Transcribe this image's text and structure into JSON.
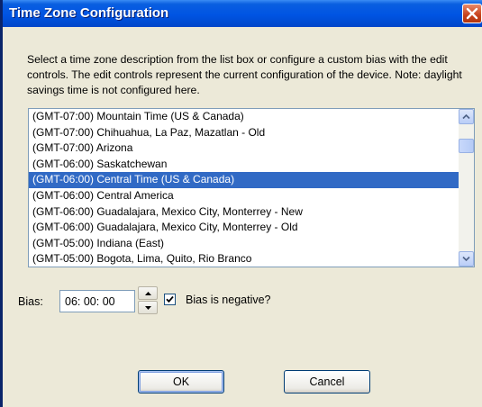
{
  "window": {
    "title": "Time Zone Configuration",
    "description": "Select a time zone description from the list box or configure a custom bias with the edit controls.  The edit controls represent the current configuration of the device.  Note: daylight savings time is not configured here."
  },
  "timezones": {
    "items": [
      "(GMT-07:00) Mountain Time (US & Canada)",
      "(GMT-07:00) Chihuahua, La Paz, Mazatlan - Old",
      "(GMT-07:00) Arizona",
      "(GMT-06:00) Saskatchewan",
      "(GMT-06:00) Central Time (US & Canada)",
      "(GMT-06:00) Central America",
      "(GMT-06:00) Guadalajara, Mexico City, Monterrey - New",
      "(GMT-06:00) Guadalajara, Mexico City, Monterrey - Old",
      "(GMT-05:00) Indiana (East)",
      "(GMT-05:00) Bogota, Lima, Quito, Rio Branco"
    ],
    "selected": "(GMT-06:00) Central Time (US & Canada)"
  },
  "bias": {
    "label": "Bias:",
    "value": "06: 00: 00"
  },
  "negative": {
    "label": "Bias is negative?",
    "checked": true
  },
  "buttons": {
    "ok": "OK",
    "cancel": "Cancel"
  },
  "icons": {
    "close": "close-icon",
    "scroll_up": "chevron-up-icon",
    "scroll_down": "chevron-down-icon",
    "spin_up": "triangle-up-icon",
    "spin_down": "triangle-down-icon",
    "check": "checkmark-icon"
  },
  "colors": {
    "titlebar": "#0054e3",
    "selection": "#316ac5",
    "close_button": "#c6411b",
    "dialog_bg": "#ece9d8"
  }
}
